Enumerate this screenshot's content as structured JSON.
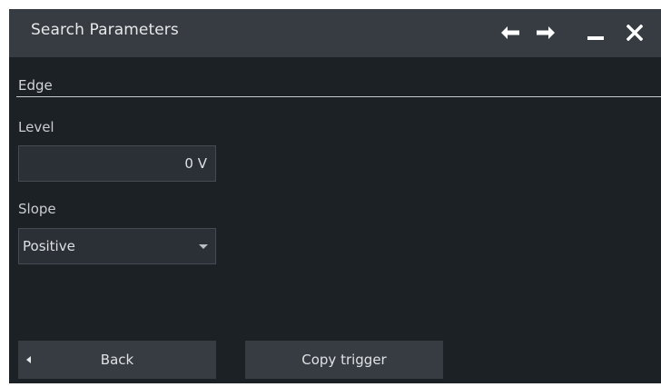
{
  "dialog": {
    "title": "Search Parameters",
    "icons": {
      "back": "arrow-left-icon",
      "forward": "arrow-right-icon",
      "minimize": "minimize-icon",
      "close": "close-icon"
    }
  },
  "section": {
    "title": "Edge"
  },
  "level": {
    "label": "Level",
    "value": "0 V"
  },
  "slope": {
    "label": "Slope",
    "selected": "Positive"
  },
  "buttons": {
    "back_label": "Back",
    "copy_label": "Copy trigger"
  },
  "colors": {
    "background": "#1c2126",
    "titlebar": "#363c42",
    "field": "#2a3036",
    "text": "#dde0e3"
  }
}
